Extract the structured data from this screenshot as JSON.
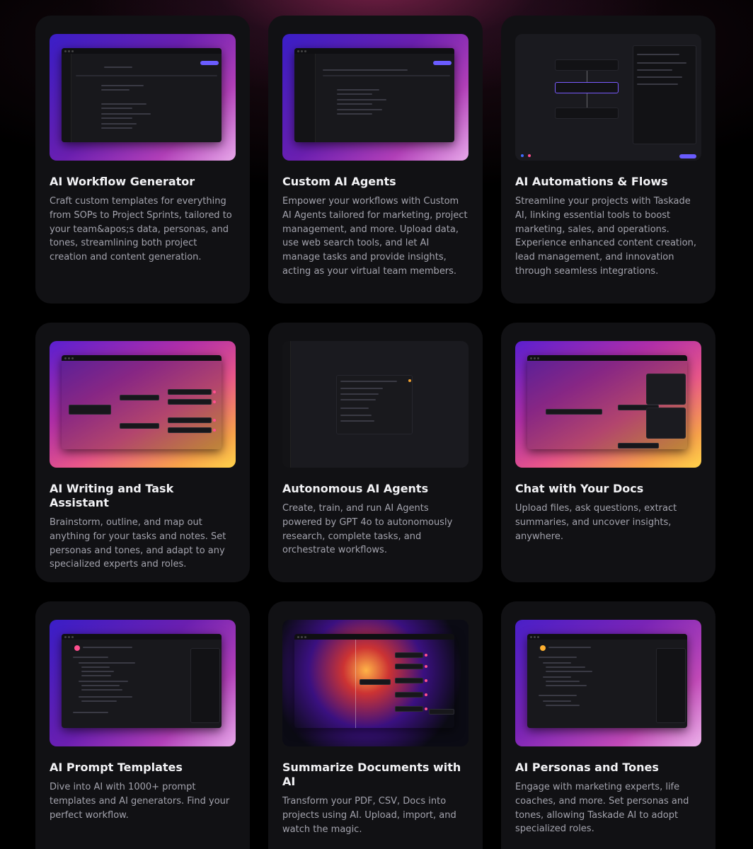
{
  "cards": [
    {
      "title": "AI Workflow Generator",
      "description": "Craft custom templates for everything from SOPs to Project Sprints, tailored to your team&apos;s data, personas, and tones, streamlining both project creation and content generation."
    },
    {
      "title": "Custom AI Agents",
      "description": "Empower your workflows with Custom AI Agents tailored for marketing, project management, and more. Upload data, use web search tools, and let AI manage tasks and provide insights, acting as your virtual team members."
    },
    {
      "title": "AI Automations & Flows",
      "description": "Streamline your projects with Taskade AI, linking essential tools to boost marketing, sales, and operations. Experience enhanced content creation, lead management, and innovation through seamless integrations."
    },
    {
      "title": "AI Writing and Task Assistant",
      "description": "Brainstorm, outline, and map out anything for your tasks and notes. Set personas and tones, and adapt to any specialized experts and roles."
    },
    {
      "title": "Autonomous AI Agents",
      "description": "Create, train, and run AI Agents powered by GPT 4o to autonomously research, complete tasks, and orchestrate workflows."
    },
    {
      "title": "Chat with Your Docs",
      "description": "Upload files, ask questions, extract summaries, and uncover insights, anywhere."
    },
    {
      "title": "AI Prompt Templates",
      "description": "Dive into AI with 1000+ prompt templates and AI generators. Find your perfect workflow."
    },
    {
      "title": "Summarize Documents with AI",
      "description": "Transform your PDF, CSV, Docs into projects using AI. Upload, import, and watch the magic."
    },
    {
      "title": "AI Personas and Tones",
      "description": "Engage with marketing experts, life coaches, and more. Set personas and tones, allowing Taskade AI to adopt specialized roles."
    }
  ],
  "colors": {
    "page_bg": "#000000",
    "card_bg": "#111114",
    "title": "#f2f2f5",
    "description": "#a3a3ad",
    "accent_purple": "#6b1fb0",
    "accent_pink": "#ff4f8f"
  }
}
